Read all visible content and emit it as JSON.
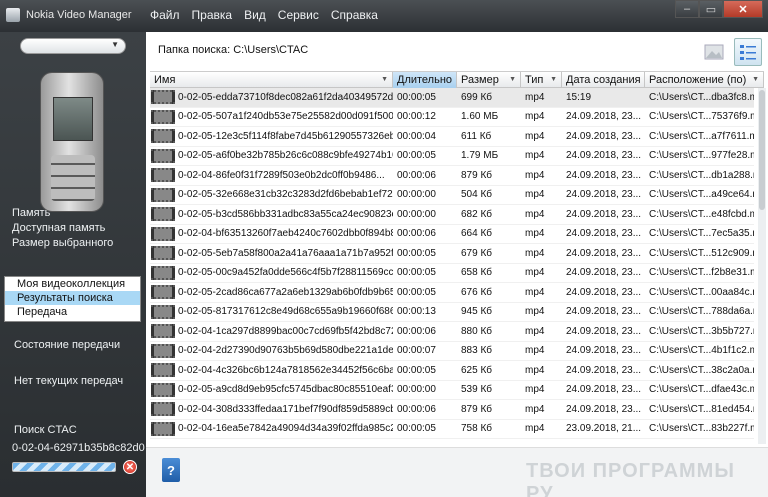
{
  "app": {
    "title": "Nokia Video Manager"
  },
  "menu": [
    "Файл",
    "Правка",
    "Вид",
    "Сервис",
    "Справка"
  ],
  "window": {
    "minimize": "–",
    "maximize": "▭",
    "close": "✕"
  },
  "sidebar": {
    "device_value": "",
    "memory": [
      "Память",
      "Доступная память",
      "Размер выбранного"
    ],
    "nav": [
      "Моя видеоколлекция",
      "Результаты поиска",
      "Передача"
    ],
    "transfer_status": "Состояние передачи",
    "no_transfers": "Нет текущих передач",
    "search_label": "Поиск CTAC",
    "search_file": "0-02-04-62971b35b8c82d0"
  },
  "main": {
    "search_path": "Папка поиска: C:\\Users\\CTAC",
    "columns": [
      "Имя",
      "Длительно",
      "Размер",
      "Тип",
      "Дата создания",
      "Расположение (по)"
    ],
    "rows": [
      [
        "0-02-05-edda73710f8dec082a61f2da40349572df...",
        "00:00:05",
        "699 Кб",
        "mp4",
        "15:19",
        "C:\\Users\\CT...dba3fc8.mp4"
      ],
      [
        "0-02-05-507a1f240db53e75e25582d00d091f500a...",
        "00:00:12",
        "1.60 МБ",
        "mp4",
        "24.09.2018, 23...",
        "C:\\Users\\CT...75376f9.mp4"
      ],
      [
        "0-02-05-12e3c5f114f8fabe7d45b61290557326eb...",
        "00:00:04",
        "611 Кб",
        "mp4",
        "24.09.2018, 23...",
        "C:\\Users\\CT...a7f7611.mp4"
      ],
      [
        "0-02-05-a6f0be32b785b26c6c088c9bfe49274b10...",
        "00:00:05",
        "1.79 МБ",
        "mp4",
        "24.09.2018, 23...",
        "C:\\Users\\CT...977fe28.mp4"
      ],
      [
        "0-02-04-86fe0f31f7289f503e0b2dc0ff0b9486...",
        "00:00:06",
        "879 Кб",
        "mp4",
        "24.09.2018, 23...",
        "C:\\Users\\CT...db1a288.mp4"
      ],
      [
        "0-02-05-32e668e31cb32c3283d2fd6bebab1ef720...",
        "00:00:00",
        "504 Кб",
        "mp4",
        "24.09.2018, 23...",
        "C:\\Users\\CT...a49ce64.mp4"
      ],
      [
        "0-02-05-b3cd586bb331adbc83a55ca24ec90823e0...",
        "00:00:00",
        "682 Кб",
        "mp4",
        "24.09.2018, 23...",
        "C:\\Users\\CT...e48fcbd.mp4"
      ],
      [
        "0-02-04-bf63513260f7aeb4240c7602dbb0f894b8...",
        "00:00:06",
        "664 Кб",
        "mp4",
        "24.09.2018, 23...",
        "C:\\Users\\CT...7ec5a35.mp4"
      ],
      [
        "0-02-05-5eb7a58f800a2a41a76aaa1a71b7a952fa...",
        "00:00:05",
        "679 Кб",
        "mp4",
        "24.09.2018, 23...",
        "C:\\Users\\CT...512c909.mp4"
      ],
      [
        "0-02-05-00c9a452fa0dde566c4f5b7f28811569ccd...",
        "00:00:05",
        "658 Кб",
        "mp4",
        "24.09.2018, 23...",
        "C:\\Users\\CT...f2b8e31.mp4"
      ],
      [
        "0-02-05-2cad86ca677a2a6eb1329ab6b0fdb9b658...",
        "00:00:05",
        "676 Кб",
        "mp4",
        "24.09.2018, 23...",
        "C:\\Users\\CT...00aa84c.mp4"
      ],
      [
        "0-02-05-817317612c8e49d68c655a9b19660f686d...",
        "00:00:13",
        "945 Кб",
        "mp4",
        "24.09.2018, 23...",
        "C:\\Users\\CT...788da6a.mp4"
      ],
      [
        "0-02-04-1ca297d8899bac00c7cd69fb5f42bd8c72...",
        "00:00:06",
        "880 Кб",
        "mp4",
        "24.09.2018, 23...",
        "C:\\Users\\CT...3b5b727.mp4"
      ],
      [
        "0-02-04-2d27390d90763b5b69d580dbe221a1de...",
        "00:00:07",
        "883 Кб",
        "mp4",
        "24.09.2018, 23...",
        "C:\\Users\\CT...4b1f1c2.mp4"
      ],
      [
        "0-02-04-4c326bc6b124a7818562e34452f56c6ba4...",
        "00:00:05",
        "625 Кб",
        "mp4",
        "24.09.2018, 23...",
        "C:\\Users\\CT...38c2a0a.mp4"
      ],
      [
        "0-02-05-a9cd8d9eb95cfc5745dbac80c85510eaf3...",
        "00:00:00",
        "539 Кб",
        "mp4",
        "24.09.2018, 23...",
        "C:\\Users\\CT...dfae43c.mp4"
      ],
      [
        "0-02-04-308d333ffedaa171bef7f90df859d5889cb...",
        "00:00:06",
        "879 Кб",
        "mp4",
        "24.09.2018, 23...",
        "C:\\Users\\CT...81ed454.mp4"
      ],
      [
        "0-02-04-16ea5e7842a49094d34a39f02ffda985c2...",
        "00:00:05",
        "758 Кб",
        "mp4",
        "23.09.2018, 21...",
        "C:\\Users\\CT...83b227f.mp4"
      ]
    ]
  },
  "footer": {
    "help": "?",
    "watermark": "ТВОИ ПРОГРАММЫ РУ"
  }
}
